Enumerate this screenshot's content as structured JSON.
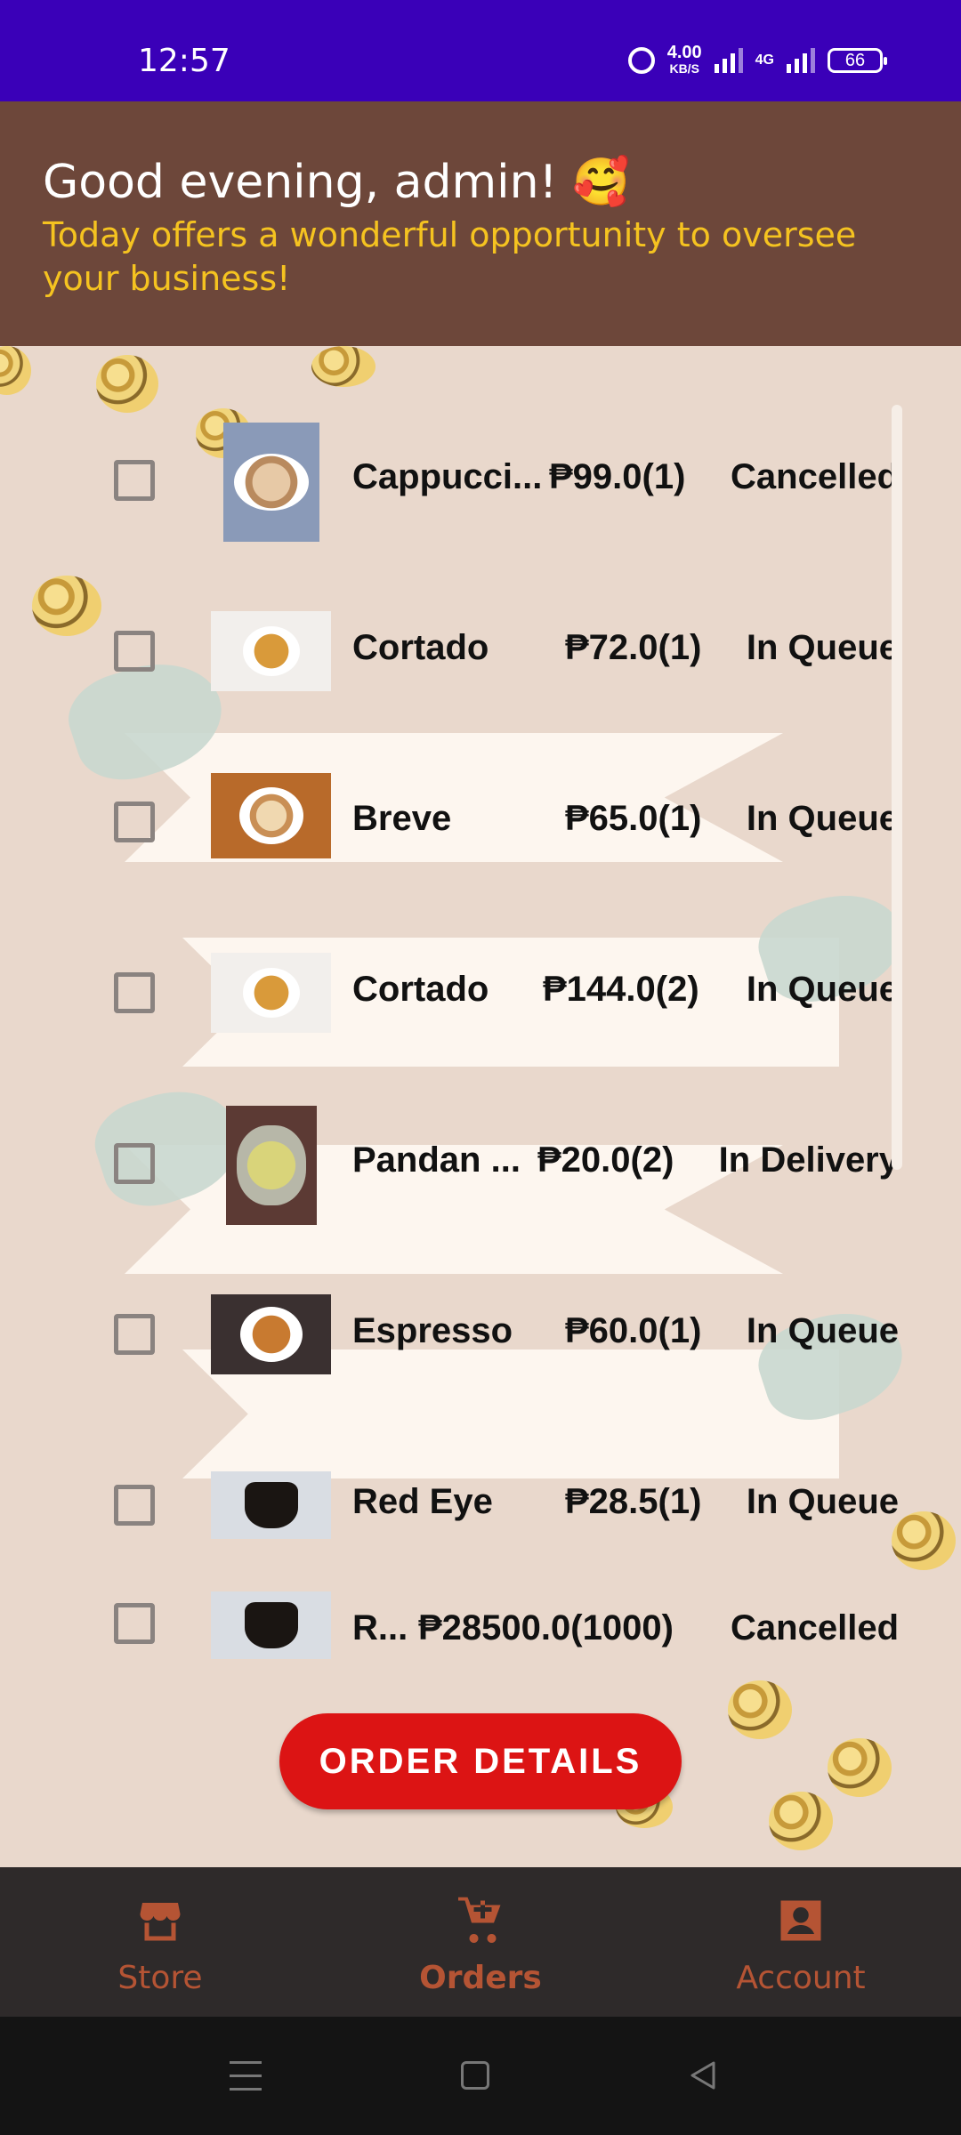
{
  "status_bar": {
    "time": "12:57",
    "net_speed_value": "4.00",
    "net_speed_unit": "KB/S",
    "network": "4G",
    "battery": "66"
  },
  "header": {
    "greeting": "Good evening, admin! 🥰",
    "subtitle": "Today offers a wonderful opportunity to oversee your business!"
  },
  "orders": [
    {
      "name": "Cappucci...",
      "price": "₱99.0(1)",
      "status": "Cancelled"
    },
    {
      "name": "Cortado",
      "price": "₱72.0(1)",
      "status": "In Queue"
    },
    {
      "name": "Breve",
      "price": "₱65.0(1)",
      "status": "In Queue"
    },
    {
      "name": "Cortado",
      "price": "₱144.0(2)",
      "status": "In Queue"
    },
    {
      "name": "Pandan ...",
      "price": "₱20.0(2)",
      "status": "In Delivery"
    },
    {
      "name": "Espresso",
      "price": "₱60.0(1)",
      "status": "In Queue"
    },
    {
      "name": "Red Eye",
      "price": "₱28.5(1)",
      "status": "In Queue"
    },
    {
      "name": "R...",
      "price": "₱28500.0(1000)",
      "status": "Cancelled"
    }
  ],
  "actions": {
    "order_details": "ORDER DETAILS"
  },
  "bottom_nav": [
    {
      "label": "Store",
      "icon": "store-icon"
    },
    {
      "label": "Orders",
      "icon": "cart-icon"
    },
    {
      "label": "Account",
      "icon": "account-icon"
    }
  ],
  "colors": {
    "status_bar": "#3a00b8",
    "header": "#6d473a",
    "subtitle": "#f5c320",
    "page_background": "#e9d8cc",
    "button": "#dc1414",
    "nav_background": "#2e2a2a",
    "nav_accent": "#b55434"
  }
}
